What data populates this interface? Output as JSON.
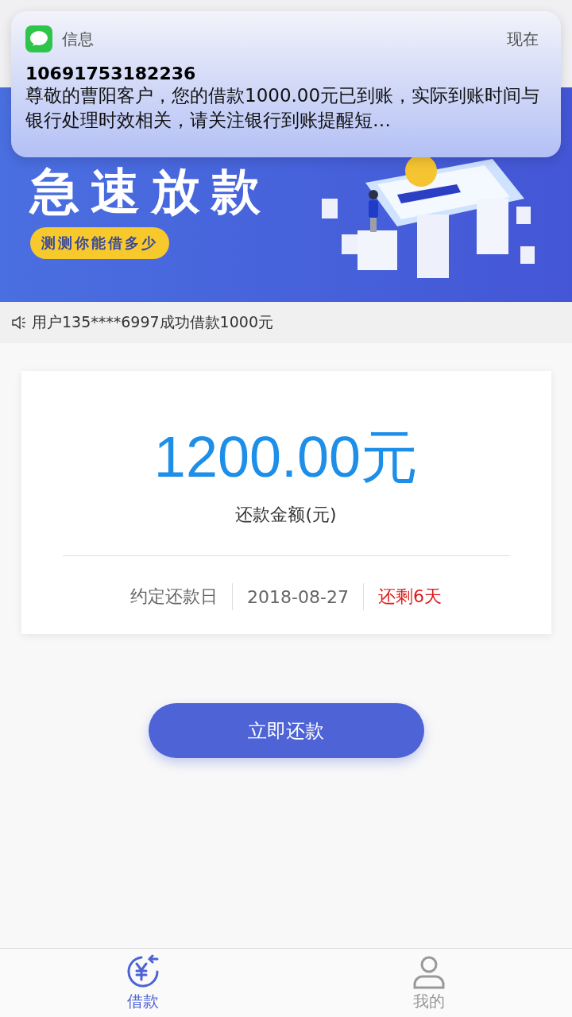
{
  "notification": {
    "app": "信息",
    "time": "现在",
    "sender": "10691753182236",
    "body": "尊敬的曹阳客户，您的借款1000.00元已到账，实际到账时间与银行处理时效相关，请关注银行到账提醒短…"
  },
  "banner": {
    "title": "急速放款",
    "button": "测测你能借多少"
  },
  "ticker": {
    "text": "用户135****6997成功借款1000元"
  },
  "repayment": {
    "amount": "1200.00元",
    "label": "还款金额(元)",
    "due_label": "约定还款日",
    "due_date": "2018-08-27",
    "remaining": "还剩6天"
  },
  "action_button": "立即还款",
  "tabs": [
    {
      "label": "借款",
      "kind": "loan",
      "selected": true
    },
    {
      "label": "我的",
      "kind": "profile",
      "selected": false
    }
  ]
}
